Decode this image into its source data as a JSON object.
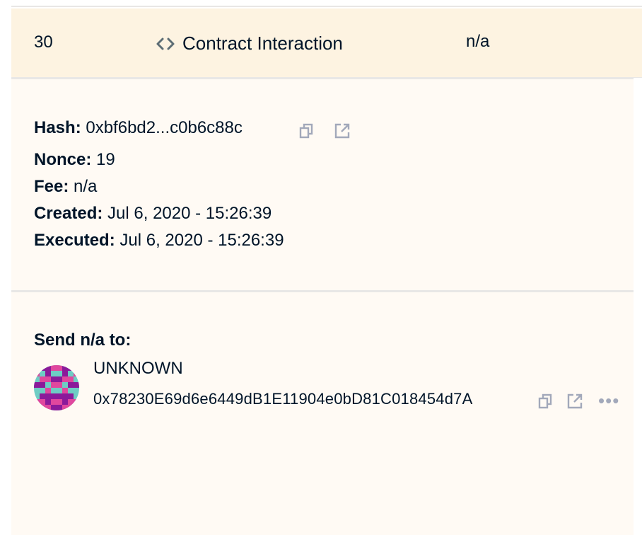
{
  "transaction_row": {
    "nonce": "30",
    "type_label": "Contract Interaction",
    "amount": "n/a"
  },
  "details": {
    "hash_label": "Hash:",
    "hash_value": "0xbf6bd2...c0b6c88c",
    "nonce_label": "Nonce:",
    "nonce_value": "19",
    "fee_label": "Fee:",
    "fee_value": "n/a",
    "created_label": "Created:",
    "created_value": "Jul 6, 2020 - 15:26:39",
    "executed_label": "Executed:",
    "executed_value": "Jul 6, 2020 - 15:26:39"
  },
  "recipient": {
    "title": "Send n/a to:",
    "name": "UNKNOWN",
    "address": "0x78230E69d6e6449dB1E11904e0bD81C018454d7A",
    "more_label": "•••"
  },
  "colors": {
    "row_background": "#fdf3e1",
    "panel_background": "#fffaf4",
    "text": "#001428",
    "icon_gray": "#a2a8ba",
    "avatar_purple": "#8b1a9a",
    "avatar_pink": "#e0479e",
    "avatar_teal": "#6ecdc4"
  },
  "icons": {
    "type_icon": "code-icon",
    "copy_icon": "copy-icon",
    "external_link_icon": "external-link-icon",
    "more_icon": "more-dots-icon"
  }
}
